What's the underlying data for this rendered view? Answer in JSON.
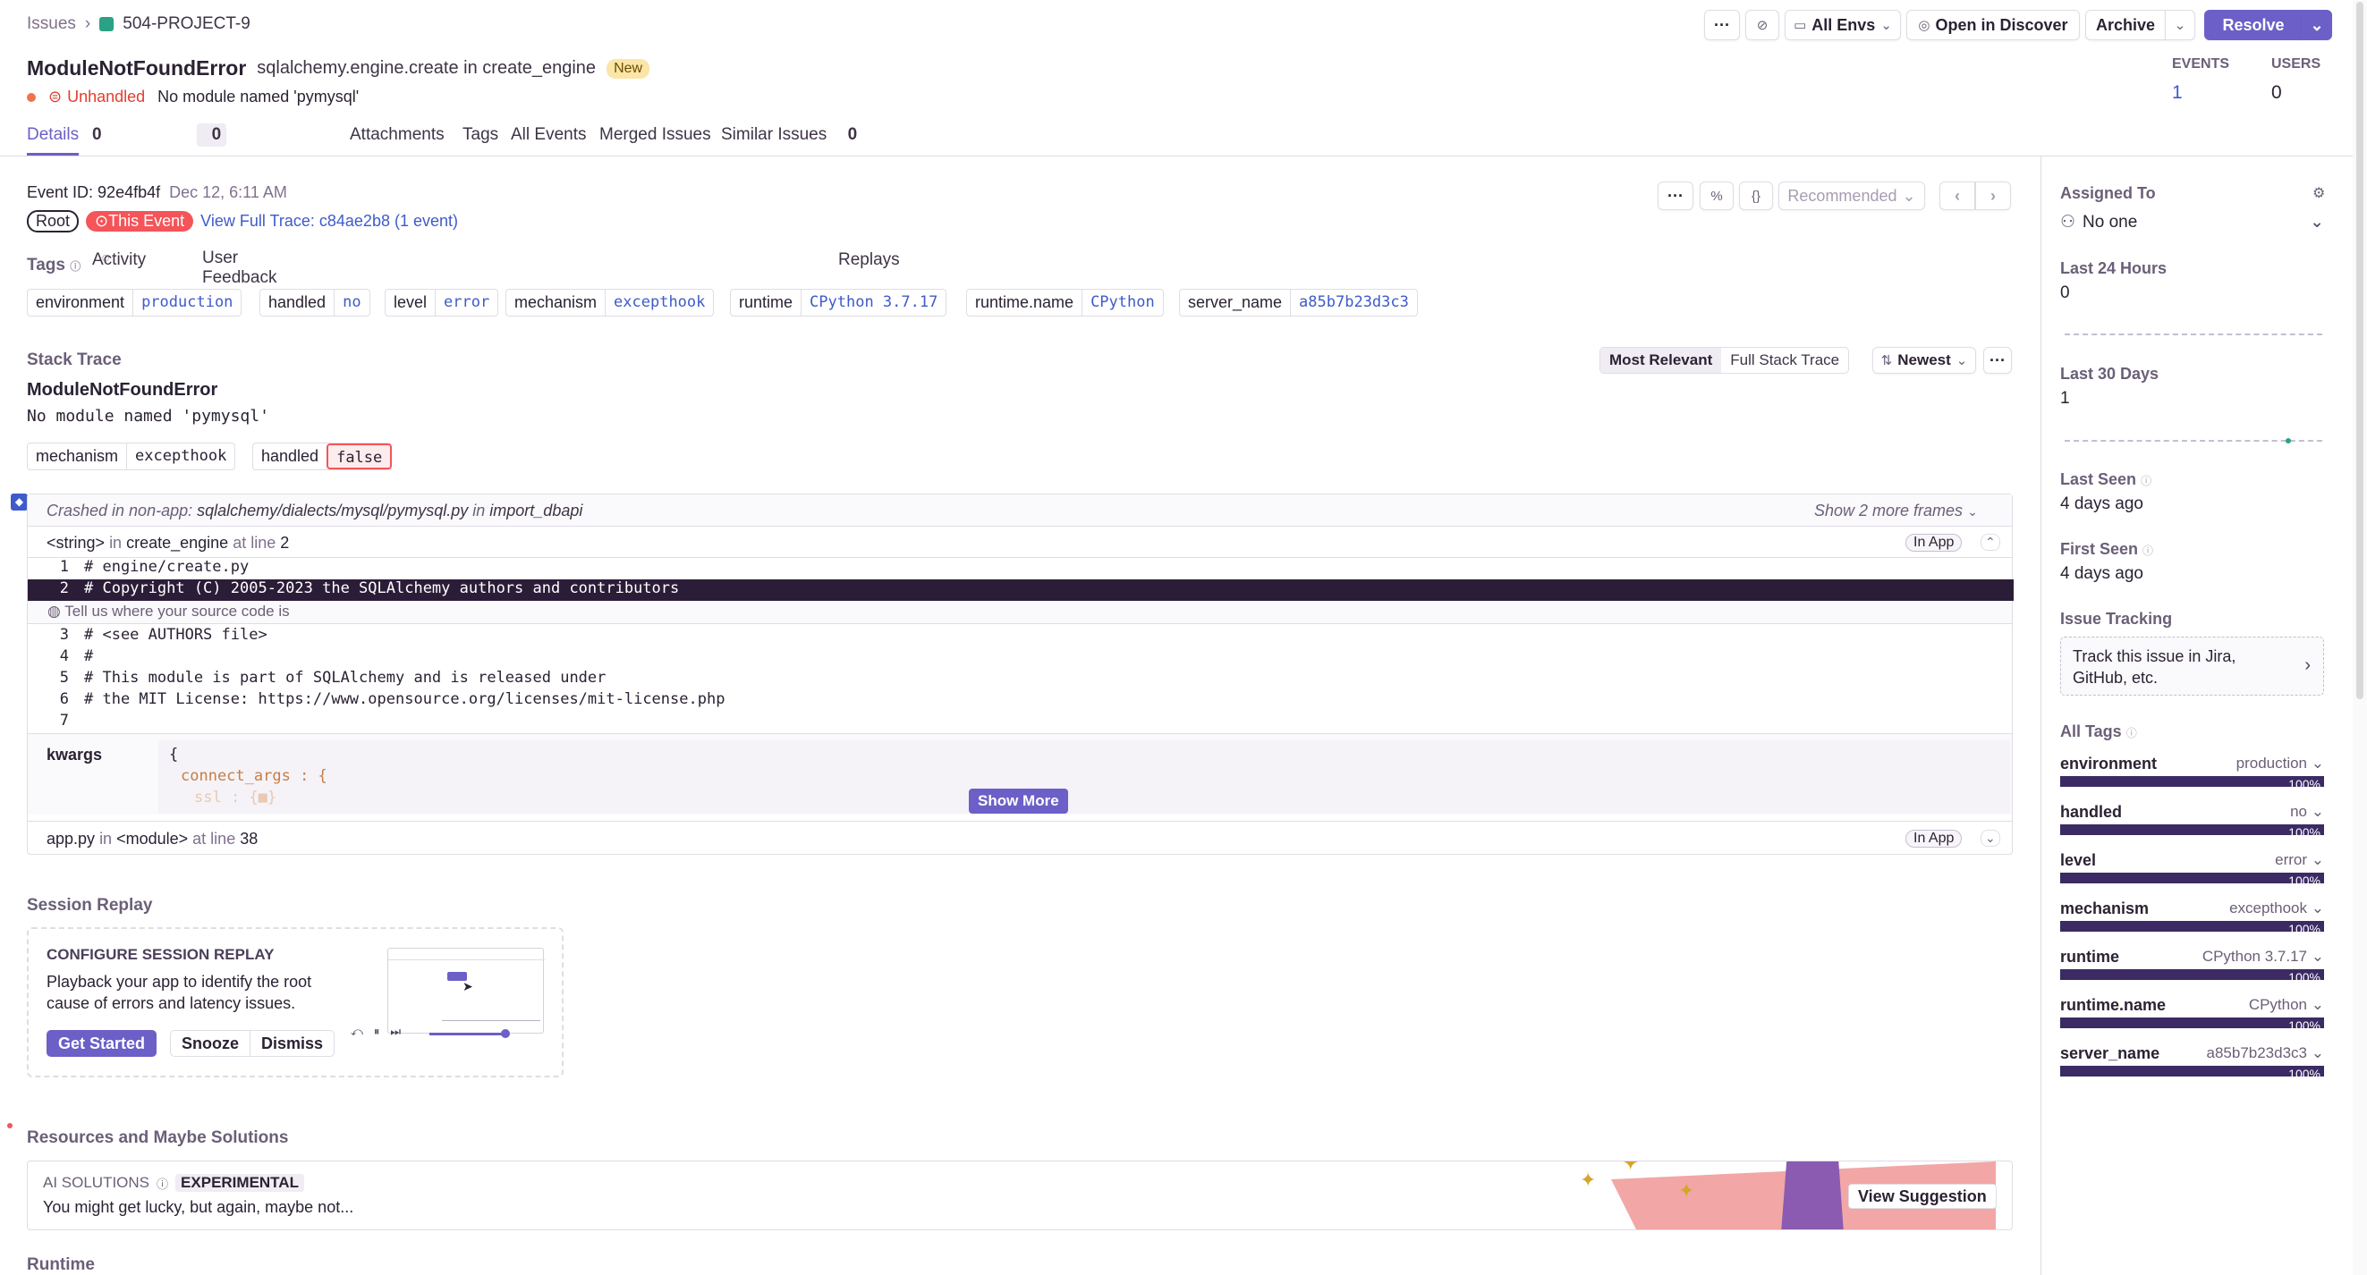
{
  "breadcrumb": {
    "root": "Issues",
    "sep": "›",
    "project": "504-PROJECT-9"
  },
  "header_buttons": {
    "more": "···",
    "mute": "⊘",
    "env": "All Envs",
    "discover": "Open in Discover",
    "archive": "Archive",
    "resolve": "Resolve"
  },
  "issue": {
    "title": "ModuleNotFoundError",
    "culprit": "sqlalchemy.engine.create in create_engine",
    "badge": "New",
    "status": "Unhandled",
    "message": "No module named 'pymysql'"
  },
  "stats": {
    "events_label": "EVENTS",
    "events_value": "1",
    "users_label": "USERS",
    "users_value": "0"
  },
  "tabs": {
    "details": "Details",
    "activity": "Activity",
    "activity_count": "0",
    "feedback": "User Feedback",
    "feedback_count": "0",
    "attachments": "Attachments",
    "tags": "Tags",
    "all_events": "All Events",
    "merged": "Merged Issues",
    "similar": "Similar Issues",
    "replays": "Replays",
    "replays_count": "0"
  },
  "event": {
    "id_label": "Event ID:",
    "id": "92e4fb4f",
    "date": "Dec 12, 6:11 AM",
    "root": "Root",
    "this_event": "This Event",
    "trace_link": "View Full Trace: c84ae2b8 (1 event)",
    "recommended": "Recommended"
  },
  "tags_section": {
    "title": "Tags",
    "items": [
      {
        "key": "environment",
        "value": "production"
      },
      {
        "key": "handled",
        "value": "no"
      },
      {
        "key": "level",
        "value": "error"
      },
      {
        "key": "mechanism",
        "value": "excepthook"
      },
      {
        "key": "runtime",
        "value": "CPython 3.7.17"
      },
      {
        "key": "runtime.name",
        "value": "CPython"
      },
      {
        "key": "server_name",
        "value": "a85b7b23d3c3"
      }
    ]
  },
  "stack": {
    "title": "Stack Trace",
    "most_relevant": "Most Relevant",
    "full": "Full Stack Trace",
    "sort": "Newest",
    "exception": "ModuleNotFoundError",
    "message": "No module named 'pymysql'",
    "mech_key": "mechanism",
    "mech_value": "excepthook",
    "handled_key": "handled",
    "handled_value": "false",
    "crashed_prefix": "Crashed in non-app:",
    "crashed_path": "sqlalchemy/dialects/mysql/pymysql.py",
    "crashed_in": "in",
    "crashed_fn": "import_dbapi",
    "show_more_frames": "Show 2 more frames",
    "frame1": {
      "file": "<string>",
      "in": "in",
      "fn": "create_engine",
      "at": "at line",
      "line": "2",
      "inapp": "In App"
    },
    "code": [
      {
        "n": "1",
        "t": "# engine/create.py"
      },
      {
        "n": "2",
        "t": "# Copyright (C) 2005-2023 the SQLAlchemy authors and contributors"
      },
      {
        "n": "3",
        "t": "# <see AUTHORS file>"
      },
      {
        "n": "4",
        "t": "#"
      },
      {
        "n": "5",
        "t": "# This module is part of SQLAlchemy and is released under"
      },
      {
        "n": "6",
        "t": "# the MIT License: https://www.opensource.org/licenses/mit-license.php"
      },
      {
        "n": "7",
        "t": ""
      }
    ],
    "source_hint": "Tell us where your source code is",
    "var_name": "kwargs",
    "var_open": "{",
    "var_key1": "connect_args",
    "var_key2": "ssl",
    "show_more": "Show More",
    "frame2": {
      "file": "app.py",
      "in": "in",
      "fn": "<module>",
      "at": "at line",
      "line": "38",
      "inapp": "In App"
    }
  },
  "replay": {
    "title": "Session Replay",
    "heading": "CONFIGURE SESSION REPLAY",
    "desc": "Playback your app to identify the root cause of errors and latency issues.",
    "get_started": "Get Started",
    "snooze": "Snooze",
    "dismiss": "Dismiss"
  },
  "resources": {
    "title": "Resources and Maybe Solutions",
    "ai": "AI SOLUTIONS",
    "experimental": "EXPERIMENTAL",
    "tagline": "You might get lucky, but again, maybe not...",
    "view": "View Suggestion"
  },
  "runtime": {
    "title": "Runtime"
  },
  "sidebar": {
    "assigned_label": "Assigned To",
    "assigned_value": "No one",
    "last24_label": "Last 24 Hours",
    "last24_value": "0",
    "last30_label": "Last 30 Days",
    "last30_value": "1",
    "last_seen_label": "Last Seen",
    "last_seen_value": "4 days ago",
    "first_seen_label": "First Seen",
    "first_seen_value": "4 days ago",
    "tracking_label": "Issue Tracking",
    "tracking_text": "Track this issue in Jira, GitHub, etc.",
    "all_tags_label": "All Tags",
    "tags": [
      {
        "name": "environment",
        "value": "production",
        "pct": "100%"
      },
      {
        "name": "handled",
        "value": "no",
        "pct": "100%"
      },
      {
        "name": "level",
        "value": "error",
        "pct": "100%"
      },
      {
        "name": "mechanism",
        "value": "excepthook",
        "pct": "100%"
      },
      {
        "name": "runtime",
        "value": "CPython 3.7.17",
        "pct": "100%"
      },
      {
        "name": "runtime.name",
        "value": "CPython",
        "pct": "100%"
      },
      {
        "name": "server_name",
        "value": "a85b7b23d3c3",
        "pct": "100%"
      }
    ]
  },
  "colors": {
    "accent": "#6c5fc7",
    "error": "#f55459",
    "link": "#3e5bc9",
    "bar": "#3b2a63",
    "highlight": "#2b1d38",
    "warning_badge": "#f5d899"
  }
}
